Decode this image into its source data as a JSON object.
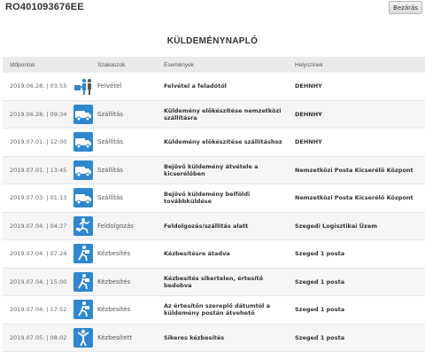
{
  "header": {
    "tracking_id": "RO401093676EE",
    "close_label": "Bezárás"
  },
  "title": "KÜLDEMÉNYNAPLÓ",
  "columns": {
    "time": "Időpontok",
    "stage": "Szakaszok",
    "event": "Események",
    "place": "Helyszínek"
  },
  "rows": [
    {
      "time": "2019.06.28. | 03:55",
      "icon": "handover-icon",
      "stage": "Felvétel",
      "event": "Felvétel a feladótól",
      "place": "DEHNHY"
    },
    {
      "time": "2019.06.28. | 09:34",
      "icon": "truck-icon",
      "stage": "Szállítás",
      "event": "Küldemény előkészítése nemzetközi szállításra",
      "place": "DEHNHY"
    },
    {
      "time": "2019.07.01. | 12:00",
      "icon": "truck-icon",
      "stage": "Szállítás",
      "event": "Küldemény előkészítése szállításhoz",
      "place": "DEHNHY"
    },
    {
      "time": "2019.07.01. | 13:45",
      "icon": "truck-icon",
      "stage": "Szállítás",
      "event": "Bejövő küldemény átvétele a kicserélőben",
      "place": "Nemzetközi Posta Kicserélő Központ"
    },
    {
      "time": "2019.07.03. | 01:13",
      "icon": "truck-icon",
      "stage": "Szállítás",
      "event": "Bejövő küldemény belföldi továbbküldése",
      "place": "Nemzetközi Posta Kicserélő Központ"
    },
    {
      "time": "2019.07.04. | 04:27",
      "icon": "sorting-icon",
      "stage": "Feldolgozás",
      "event": "Feldolgozás/szállítás alatt",
      "place": "Szegedi Logisztikai Üzem"
    },
    {
      "time": "2019.07.04. | 07:24",
      "icon": "courier-icon",
      "stage": "Kézbesítés",
      "event": "Kézbesítésre átadva",
      "place": "Szeged 1 posta"
    },
    {
      "time": "2019.07.04. | 15:00",
      "icon": "courier-icon",
      "stage": "Kézbesítés",
      "event": "Kézbesítés sikertelen, értesítő bedobva",
      "place": "Szeged 1 posta"
    },
    {
      "time": "2019.07.04. | 17:52",
      "icon": "courier-icon",
      "stage": "Kézbesítés",
      "event": "Az értesítőn szereplő dátumtól a küldemény postán átvehető",
      "place": "Szeged 1 posta"
    },
    {
      "time": "2019.07.05. | 08:02",
      "icon": "delivered-icon",
      "stage": "Kézbesített",
      "event": "Sikeres kézbesítés",
      "place": "Szeged 1 posta"
    }
  ],
  "colors": {
    "icon_blue": "#2f87cf",
    "header_bg": "#ebebeb"
  }
}
